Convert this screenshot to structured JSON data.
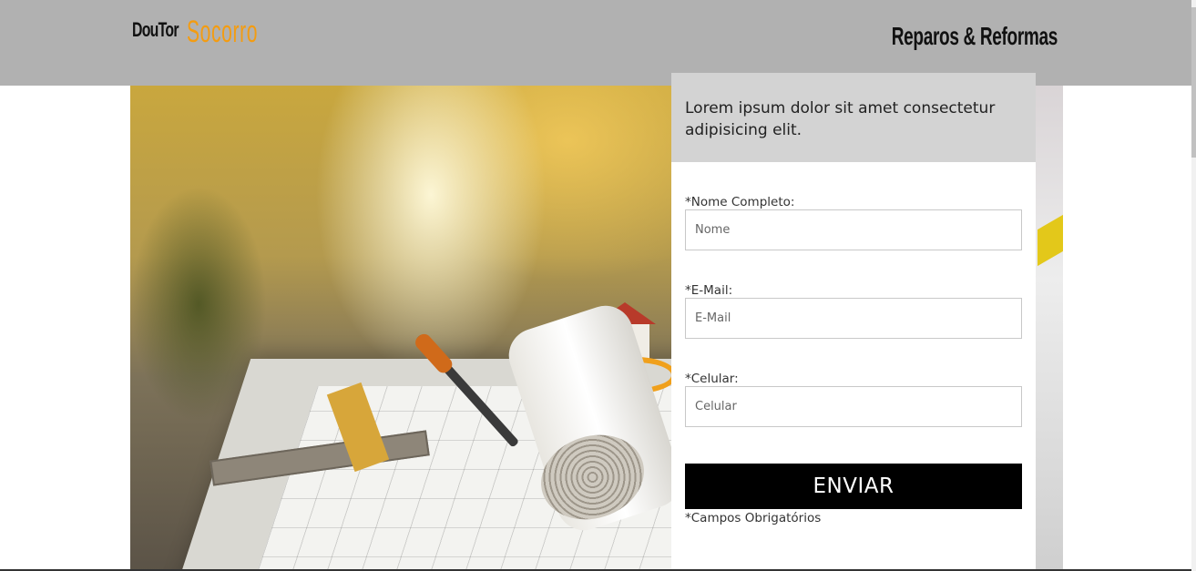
{
  "header": {
    "logo_part1": "DouTor",
    "logo_part2": "Socorro",
    "tagline": "Reparos & Reformas",
    "logo_color_accent": "#f39c12",
    "background": "#b1b1b1"
  },
  "hero": {
    "image_icon": "construction-tools-photo"
  },
  "form": {
    "heading": "Lorem ipsum dolor sit amet consectetur adipisicing elit.",
    "fields": [
      {
        "label": "*Nome Completo:",
        "placeholder": "Nome",
        "value": ""
      },
      {
        "label": "*E-Mail:",
        "placeholder": "E-Mail",
        "value": ""
      },
      {
        "label": "*Celular:",
        "placeholder": "Celular",
        "value": ""
      }
    ],
    "submit_label": "ENVIAR",
    "required_note": "*Campos Obrigatórios",
    "submit_color": "#000000"
  }
}
